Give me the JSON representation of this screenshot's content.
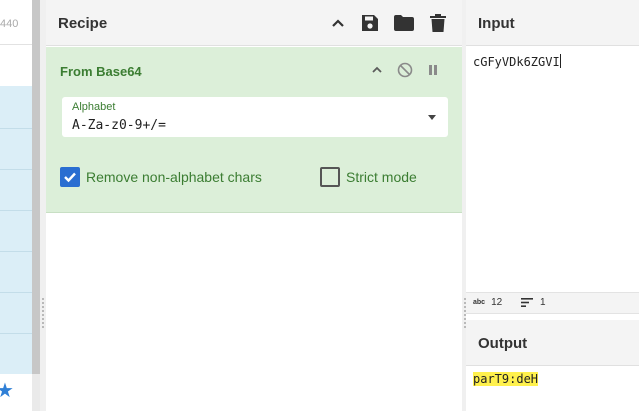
{
  "left_panel": {
    "partial_number": "440",
    "favourite_icon": "star-icon"
  },
  "recipe": {
    "title": "Recipe",
    "icons": [
      "chevron-up-icon",
      "save-icon",
      "folder-icon",
      "trash-icon"
    ],
    "operation": {
      "name": "From Base64",
      "icons": [
        "chevron-up-icon",
        "disable-icon",
        "pause-icon"
      ],
      "alphabet_label": "Alphabet",
      "alphabet_value": "A-Za-z0-9+/=",
      "checkboxes": [
        {
          "label": "Remove non-alphabet chars",
          "checked": true
        },
        {
          "label": "Strict mode",
          "checked": false
        }
      ]
    }
  },
  "input": {
    "title": "Input",
    "text": "cGFyVDk6ZGVI",
    "status_chars": "12",
    "status_lines": "1"
  },
  "output": {
    "title": "Output",
    "text": "parT9:deH"
  },
  "colors": {
    "operation_bg": "#dcefd9",
    "operation_text": "#3b7d32",
    "checkbox_checked": "#2a6ed1",
    "output_highlight": "#fff14d",
    "list_bg": "#dbeef7"
  }
}
